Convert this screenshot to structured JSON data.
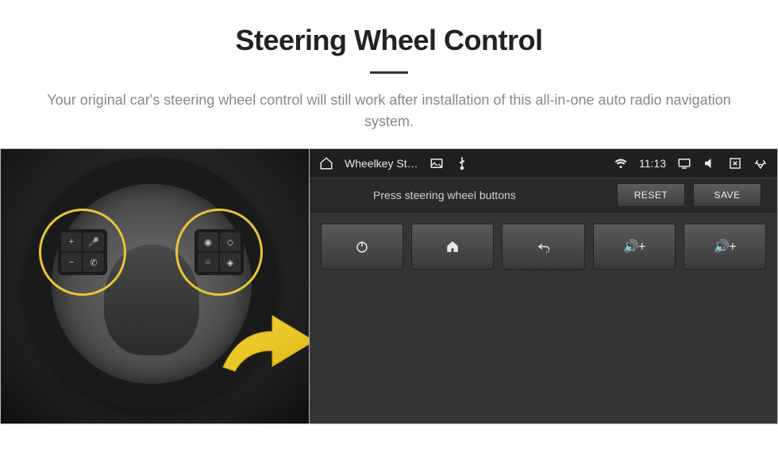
{
  "header": {
    "title": "Steering Wheel Control",
    "subtitle": "Your original car's steering wheel control will still work after installation of this all-in-one auto radio navigation system."
  },
  "wheel": {
    "left_buttons": {
      "tl": "+",
      "tr": "🎤",
      "bl": "−",
      "br": "✆"
    },
    "right_buttons": {
      "tl": "◉",
      "tr": "◇",
      "bl": "○",
      "br": "◈"
    }
  },
  "statusbar": {
    "home_icon": "home",
    "app_title": "Wheelkey St…",
    "icons_left": [
      "image",
      "usb"
    ],
    "wifi_icon": "wifi",
    "time": "11:13",
    "icons_right": [
      "cast",
      "mute",
      "close-window",
      "recycle"
    ]
  },
  "subbar": {
    "instruction": "Press steering wheel buttons",
    "reset_label": "RESET",
    "save_label": "SAVE"
  },
  "keys": {
    "items": [
      {
        "name": "power",
        "glyph": "power"
      },
      {
        "name": "home",
        "glyph": "home"
      },
      {
        "name": "back",
        "glyph": "back"
      },
      {
        "name": "vol-up-1",
        "glyph": "vol+",
        "text": "🔊+"
      },
      {
        "name": "vol-up-2",
        "glyph": "vol+",
        "text": "🔊+"
      }
    ]
  }
}
